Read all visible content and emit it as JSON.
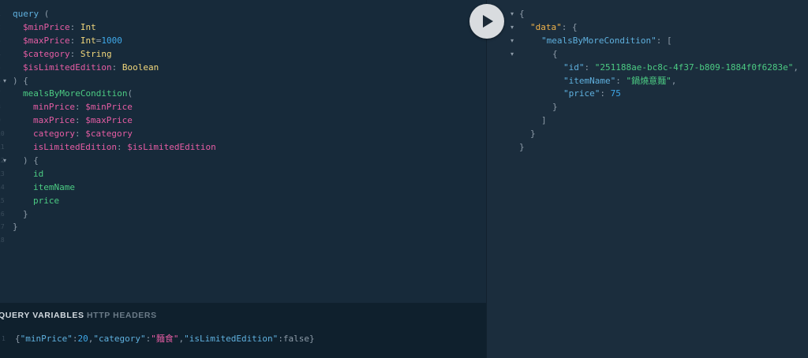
{
  "editor": {
    "lines": [
      {
        "n": "1",
        "parts": [
          [
            "kw",
            "query"
          ],
          [
            "punct",
            " ("
          ]
        ]
      },
      {
        "n": "2",
        "parts": [
          [
            "var",
            "$minPrice"
          ],
          [
            "punct",
            ": "
          ],
          [
            "type",
            "Int"
          ]
        ]
      },
      {
        "n": "3",
        "parts": [
          [
            "var",
            "$maxPrice"
          ],
          [
            "punct",
            ": "
          ],
          [
            "type",
            "Int"
          ],
          [
            "punct",
            "="
          ],
          [
            "num",
            "1000"
          ]
        ]
      },
      {
        "n": "4",
        "parts": [
          [
            "var",
            "$category"
          ],
          [
            "punct",
            ": "
          ],
          [
            "type",
            "String"
          ]
        ]
      },
      {
        "n": "5",
        "parts": [
          [
            "var",
            "$isLimitedEdition"
          ],
          [
            "punct",
            ": "
          ],
          [
            "type",
            "Boolean"
          ]
        ]
      },
      {
        "n": "6",
        "fold": true,
        "parts": [
          [
            "punct",
            ") {"
          ]
        ]
      },
      {
        "n": "7",
        "parts": [
          [
            "field",
            "mealsByMoreCondition"
          ],
          [
            "punct",
            "("
          ]
        ]
      },
      {
        "n": "8",
        "parts": [
          [
            "var",
            "minPrice"
          ],
          [
            "punct",
            ": "
          ],
          [
            "var",
            "$minPrice"
          ]
        ]
      },
      {
        "n": "9",
        "parts": [
          [
            "var",
            "maxPrice"
          ],
          [
            "punct",
            ": "
          ],
          [
            "var",
            "$maxPrice"
          ]
        ]
      },
      {
        "n": "10",
        "parts": [
          [
            "var",
            "category"
          ],
          [
            "punct",
            ": "
          ],
          [
            "var",
            "$category"
          ]
        ]
      },
      {
        "n": "11",
        "parts": [
          [
            "var",
            "isLimitedEdition"
          ],
          [
            "punct",
            ": "
          ],
          [
            "var",
            "$isLimitedEdition"
          ]
        ]
      },
      {
        "n": "12",
        "fold": true,
        "parts": [
          [
            "punct",
            ") {"
          ]
        ]
      },
      {
        "n": "13",
        "parts": [
          [
            "field",
            "id"
          ]
        ]
      },
      {
        "n": "14",
        "parts": [
          [
            "field",
            "itemName"
          ]
        ]
      },
      {
        "n": "15",
        "parts": [
          [
            "field",
            "price"
          ]
        ]
      },
      {
        "n": "16",
        "parts": [
          [
            "punct",
            "}"
          ]
        ]
      },
      {
        "n": "17",
        "parts": [
          [
            "punct",
            "}"
          ]
        ]
      },
      {
        "n": "18",
        "parts": []
      }
    ]
  },
  "run_button": {
    "icon": "play-icon"
  },
  "result": {
    "lines": [
      {
        "fold": true,
        "parts": [
          [
            "punct",
            "{"
          ]
        ]
      },
      {
        "fold": true,
        "parts": [
          [
            "jkey-data",
            "\"data\""
          ],
          [
            "punct",
            ": {"
          ]
        ]
      },
      {
        "fold": true,
        "parts": [
          [
            "key",
            "\"mealsByMoreCondition\""
          ],
          [
            "punct",
            ": ["
          ]
        ]
      },
      {
        "fold": true,
        "parts": [
          [
            "punct",
            "{"
          ]
        ]
      },
      {
        "parts": [
          [
            "key",
            "\"id\""
          ],
          [
            "punct",
            ": "
          ],
          [
            "str",
            "\"251188ae-bc8c-4f37-b809-1884f0f6283e\""
          ],
          [
            "punct",
            ","
          ]
        ]
      },
      {
        "parts": [
          [
            "key",
            "\"itemName\""
          ],
          [
            "punct",
            ": "
          ],
          [
            "str",
            "\"鍋燒意麵\""
          ],
          [
            "punct",
            ","
          ]
        ]
      },
      {
        "parts": [
          [
            "key",
            "\"price\""
          ],
          [
            "punct",
            ": "
          ],
          [
            "jnum",
            "75"
          ]
        ]
      },
      {
        "parts": [
          [
            "punct",
            "}"
          ]
        ]
      },
      {
        "parts": [
          [
            "punct",
            "]"
          ]
        ]
      },
      {
        "parts": [
          [
            "punct",
            "}"
          ]
        ]
      },
      {
        "parts": [
          [
            "punct",
            "}"
          ]
        ]
      }
    ]
  },
  "variables": {
    "tab_query_variables": "QUERY VARIABLES",
    "tab_http_headers": "HTTP HEADERS",
    "line_number": "1",
    "parts": [
      [
        "punct",
        "{"
      ],
      [
        "key",
        "\"minPrice\""
      ],
      [
        "punct",
        ":"
      ],
      [
        "jnum",
        "20"
      ],
      [
        "punct",
        ","
      ],
      [
        "key",
        "\"category\""
      ],
      [
        "punct",
        ":"
      ],
      [
        "var",
        "\"麵食\""
      ],
      [
        "punct",
        ","
      ],
      [
        "key",
        "\"isLimitedEdition\""
      ],
      [
        "punct",
        ":false}"
      ]
    ]
  }
}
